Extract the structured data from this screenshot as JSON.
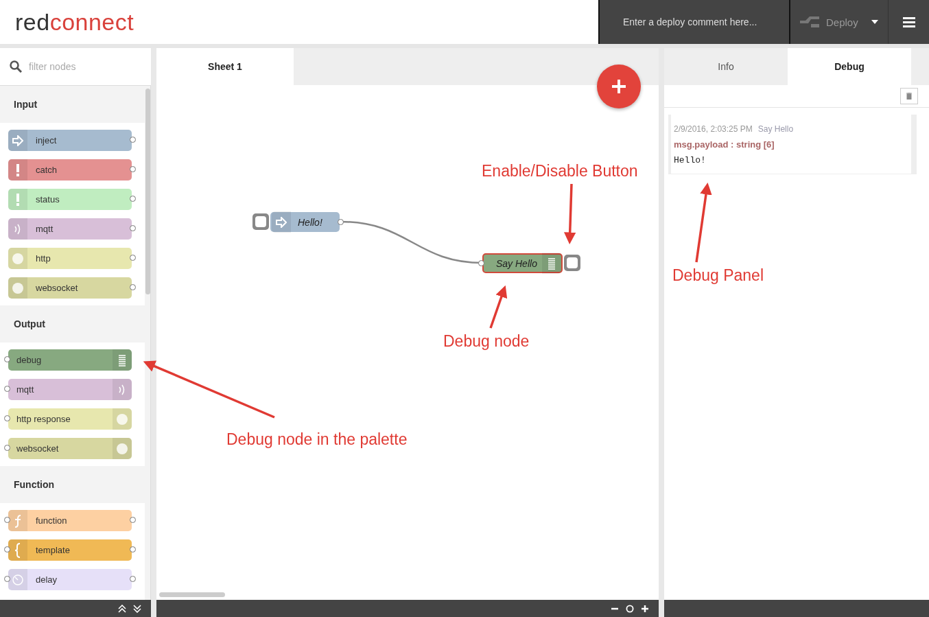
{
  "header": {
    "logo": [
      "red",
      "connect"
    ],
    "deploy_comment": {
      "placeholder": "Enter a deploy comment here..."
    },
    "deploy_button": "Deploy"
  },
  "palette": {
    "search": {
      "placeholder": "filter nodes"
    },
    "categories": [
      {
        "name": "Input",
        "nodes": [
          {
            "label": "inject",
            "color": "#a6bbcf",
            "kind": "source"
          },
          {
            "label": "catch",
            "color": "#e49191",
            "kind": "source"
          },
          {
            "label": "status",
            "color": "#c0edc0",
            "kind": "source"
          },
          {
            "label": "mqtt",
            "color": "#d8bfd8",
            "kind": "source"
          },
          {
            "label": "http",
            "color": "#e7e7ae",
            "kind": "source"
          },
          {
            "label": "websocket",
            "color": "#d7d7a0",
            "kind": "source"
          }
        ]
      },
      {
        "name": "Output",
        "nodes": [
          {
            "label": "debug",
            "color": "#87a980",
            "kind": "sink"
          },
          {
            "label": "mqtt",
            "color": "#d8bfd8",
            "kind": "sink"
          },
          {
            "label": "http response",
            "color": "#e7e7ae",
            "kind": "sink"
          },
          {
            "label": "websocket",
            "color": "#d7d7a0",
            "kind": "sink"
          }
        ]
      },
      {
        "name": "Function",
        "nodes": [
          {
            "label": "function",
            "color": "#fdd0a2",
            "kind": "process"
          },
          {
            "label": "template",
            "color": "#f0b955",
            "kind": "process"
          },
          {
            "label": "delay",
            "color": "#e6e0f8",
            "kind": "process"
          }
        ]
      }
    ]
  },
  "workspace": {
    "tabs": [
      {
        "label": "Sheet 1",
        "selected": true
      }
    ],
    "nodes": [
      {
        "label": "Hello!",
        "kind": "inject",
        "color": "#a6bbcf",
        "selected": false
      },
      {
        "label": "Say Hello",
        "kind": "debug",
        "color": "#87a980",
        "selected": true
      }
    ]
  },
  "sidebar": {
    "tabs": [
      {
        "label": "Info",
        "selected": false
      },
      {
        "label": "Debug",
        "selected": true
      }
    ],
    "messages": [
      {
        "time": "2/9/2016, 2:03:25 PM",
        "source": "Say Hello",
        "topic": "msg.payload : string [6]",
        "value": "Hello!"
      }
    ]
  },
  "annotations": [
    "Enable/Disable Button",
    "Debug node",
    "Debug node in the palette",
    "Debug Panel"
  ]
}
